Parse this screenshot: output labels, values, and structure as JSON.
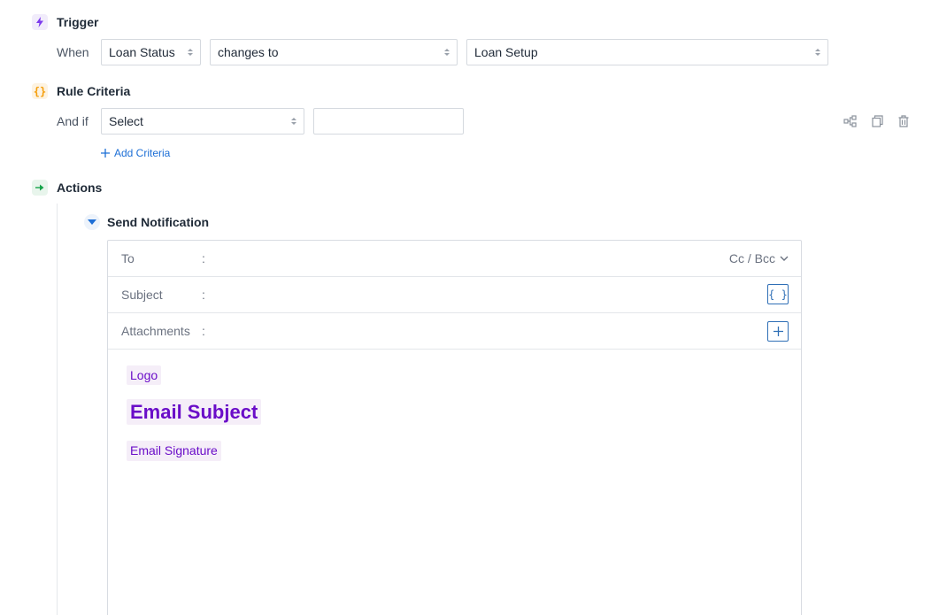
{
  "trigger": {
    "title": "Trigger",
    "when_label": "When",
    "field_select": "Loan Status",
    "operator_select": "changes to",
    "value_select": "Loan Setup"
  },
  "criteria": {
    "title": "Rule Criteria",
    "and_if_label": "And if",
    "field_select": "Select",
    "value_input": "",
    "add_label": "Add Criteria"
  },
  "actions": {
    "title": "Actions",
    "notification": {
      "title": "Send Notification",
      "to_label": "To",
      "subject_label": "Subject",
      "attachments_label": "Attachments",
      "colon": ":",
      "cc_bcc_label": "Cc / Bcc",
      "insert_field_label": "{ }",
      "body": {
        "logo": "Logo",
        "email_subject": "Email Subject",
        "email_signature": "Email Signature"
      }
    }
  },
  "icons": {
    "trigger": "lightning-icon",
    "criteria": "braces-icon",
    "actions": "arrow-right-icon",
    "expand": "caret-down-icon",
    "tree": "tree-icon",
    "copy": "copy-icon",
    "delete": "trash-icon"
  },
  "colors": {
    "trigger_icon": "#7c3aed",
    "criteria_icon": "#f59e0b",
    "actions_icon": "#16a34a",
    "link": "#1d6fd6",
    "chip_text": "#6a0dc8"
  }
}
